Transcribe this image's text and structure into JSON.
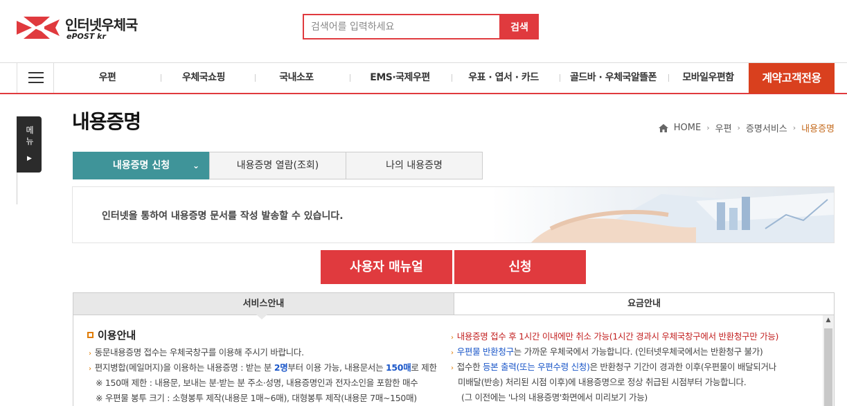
{
  "header": {
    "logo_name": "인터넷우체국",
    "logo_sub": "ePOST kr",
    "search_placeholder": "검색어를 입력하세요",
    "search_button": "검색"
  },
  "nav": {
    "items": [
      "우편",
      "우체국쇼핑",
      "국내소포",
      "EMS·국제우편",
      "우표 · 엽서 · 카드",
      "골드바 · 우체국알뜰폰",
      "모바일우편함"
    ],
    "contract": "계약고객전용"
  },
  "side_menu": {
    "label": "메뉴"
  },
  "page": {
    "title": "내용증명",
    "breadcrumb": [
      "HOME",
      "우편",
      "증명서비스",
      "내용증명"
    ]
  },
  "tabs": [
    "내용증명 신청",
    "내용증명 열람(조회)",
    "나의 내용증명"
  ],
  "banner": {
    "text": "인터넷을 통하여 내용증명 문서를 작성 발송할 수 있습니다."
  },
  "buttons": {
    "manual": "사용자 매뉴얼",
    "apply": "신청"
  },
  "info_tabs": [
    "서비스안내",
    "요금안내"
  ],
  "service": {
    "section_title": "이용안내",
    "left": {
      "l1": "동문내용증명 접수는 우체국창구를 이용해 주시기 바랍니다.",
      "l2a": "편지병합(메일머지)을 이용하는 내용증명 : 받는 분 ",
      "l2b": "2명",
      "l2c": "부터 이용 가능, 내용문서는 ",
      "l2d": "150매",
      "l2e": "로 제한",
      "l3": "※ 150매 제한 : 내용문, 보내는 분·받는 분 주소·성명, 내용증명인과 전자소인을 포함한 매수",
      "l4": "※ 우편물 봉투 크기 : 소형봉투 제작(내용문 1매~6매), 대형봉투 제작(내용문 7매~150매)"
    },
    "right": {
      "r1": "내용증명 접수 후 1시간 이내에만 취소 가능(1시간 경과시 우체국창구에서 반환청구만 가능)",
      "r2a": "우편물 반환청구",
      "r2b": "는 가까운 우체국에서 가능합니다. (인터넷우체국에서는 반환청구 불가)",
      "r3a": "접수한 ",
      "r3b": "등본 출력(또는 우편수령 신청)",
      "r3c": "은 반환청구 기간이 경과한 이후(우편물이 배달되거나",
      "r4": "미배달(반송) 처리된 시점 이후)에 내용증명으로 정상 취급된 시점부터 가능합니다.",
      "r5": "(그 이전에는 '나의 내용증명'화면에서 미리보기 가능)"
    }
  },
  "colors": {
    "brand_red": "#e03a3e",
    "teal": "#3f9499",
    "contract_orange": "#d9401e",
    "bullet_orange": "#e07b00"
  }
}
